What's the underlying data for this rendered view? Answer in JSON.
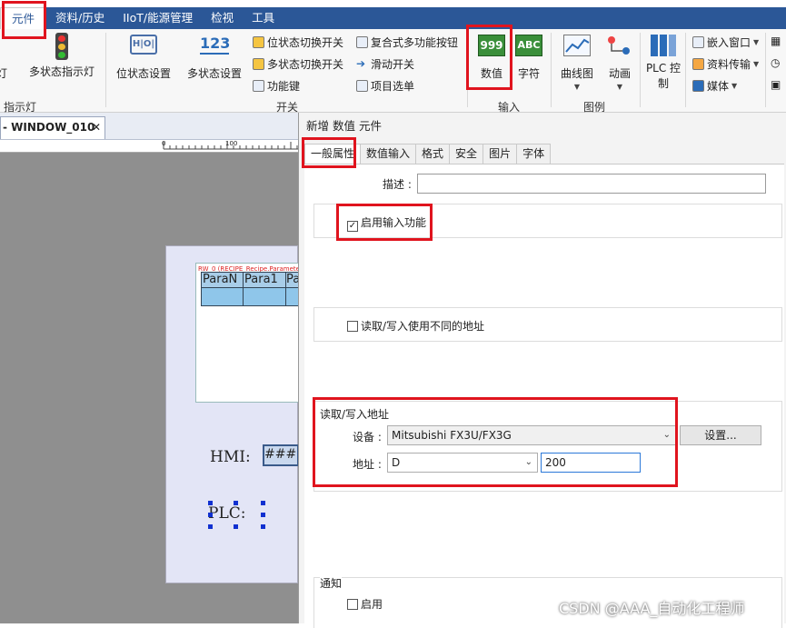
{
  "menubar": {
    "items": [
      "元件",
      "资料/历史",
      "IIoT/能源管理",
      "检视",
      "工具"
    ]
  },
  "ribbon": {
    "indicator": {
      "partial_label": "灯",
      "multi_state_label": "多状态指示灯",
      "group_label": "指示灯"
    },
    "switch": {
      "bit_state_set": "位状态设置",
      "multi_state_set": "多状态设置",
      "bit_switch": "位状态切换开关",
      "multi_switch": "多状态切换开关",
      "function_key": "功能键",
      "combo_button": "复合式多功能按钮",
      "slide_switch": "滑动开关",
      "item_list": "项目选单",
      "group_label": "开关"
    },
    "input": {
      "numeric": "数值",
      "numeric_icon_text": "999",
      "character": "字符",
      "character_icon_text": "ABC",
      "group_label": "输入"
    },
    "chart": {
      "trend": "曲线图",
      "animation": "动画",
      "group_label": "图例"
    },
    "plc": {
      "label_line1": "PLC 控",
      "label_line2": "制"
    },
    "misc": {
      "embed_window": "嵌入窗口",
      "data_transfer": "资料传输",
      "media": "媒体"
    }
  },
  "workspace": {
    "tab_title": "- WINDOW_010",
    "tab_close": "✕",
    "ruler_marks": [
      "0",
      "100"
    ],
    "recipe_label": "RW_0 (RECIPE_Recipe.Parameter",
    "table_headers": [
      "ParaN",
      "Para1",
      "Pa"
    ],
    "hmi_label": "HMI:",
    "hmi_value": "###",
    "plc_label": "PLC:"
  },
  "dialog": {
    "title": "新增 数值 元件",
    "tabs": [
      "一般属性",
      "数值输入",
      "格式",
      "安全",
      "图片",
      "字体"
    ],
    "description_label": "描述 :",
    "description_value": "",
    "enable_input": "启用输入功能",
    "enable_input_checked": true,
    "rw_diff_address": "读取/写入使用不同的地址",
    "rw_diff_address_checked": false,
    "rw_address_section": "读取/写入地址",
    "device_label": "设备 :",
    "device_value": "Mitsubishi FX3U/FX3G",
    "settings_button": "设置...",
    "address_label": "地址 :",
    "address_type": "D",
    "address_value": "200",
    "notify_section": "通知",
    "enable_label": "启用",
    "enable_checked": false
  },
  "watermark": "CSDN @AAA_自动化工程师",
  "colors": {
    "menubar_bg": "#2b5797",
    "highlight_red": "#e0141e",
    "workspace_gray": "#8f8f8f",
    "canvas_bg": "#e3e5f6"
  }
}
